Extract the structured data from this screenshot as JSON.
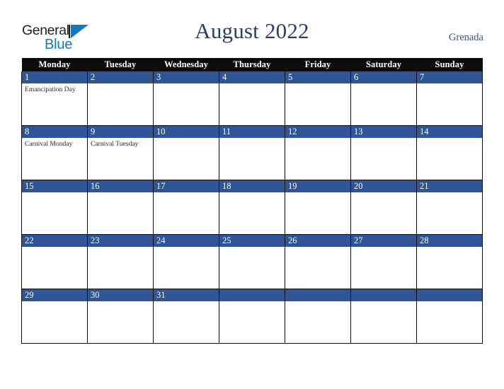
{
  "brand": {
    "name_part1": "General",
    "name_part2": "Blue",
    "mark_icon": "triangle-logo-icon",
    "color_dark": "#231f20",
    "color_blue": "#1878be"
  },
  "header": {
    "title": "August 2022",
    "region": "Grenada",
    "title_color": "#2b3f63",
    "region_color": "#3f5280"
  },
  "colors": {
    "header_row_bg": "#0c0c0c",
    "header_row_text": "#ffffff",
    "date_bar_bg": "#2f5597",
    "date_bar_text": "#ffffff",
    "cell_bg": "#fdfdfd",
    "grid_line": "#0c0c0c",
    "page_bg": "#fdfdfd",
    "event_text": "#2b2b2b"
  },
  "calendar": {
    "month": "August",
    "year": "2022",
    "weekday_headers": [
      "Monday",
      "Tuesday",
      "Wednesday",
      "Thursday",
      "Friday",
      "Saturday",
      "Sunday"
    ],
    "weeks": [
      [
        {
          "day": "1",
          "events": [
            "Emancipation Day"
          ]
        },
        {
          "day": "2",
          "events": []
        },
        {
          "day": "3",
          "events": []
        },
        {
          "day": "4",
          "events": []
        },
        {
          "day": "5",
          "events": []
        },
        {
          "day": "6",
          "events": []
        },
        {
          "day": "7",
          "events": []
        }
      ],
      [
        {
          "day": "8",
          "events": [
            "Carnival Monday"
          ]
        },
        {
          "day": "9",
          "events": [
            "Carnival Tuesday"
          ]
        },
        {
          "day": "10",
          "events": []
        },
        {
          "day": "11",
          "events": []
        },
        {
          "day": "12",
          "events": []
        },
        {
          "day": "13",
          "events": []
        },
        {
          "day": "14",
          "events": []
        }
      ],
      [
        {
          "day": "15",
          "events": []
        },
        {
          "day": "16",
          "events": []
        },
        {
          "day": "17",
          "events": []
        },
        {
          "day": "18",
          "events": []
        },
        {
          "day": "19",
          "events": []
        },
        {
          "day": "20",
          "events": []
        },
        {
          "day": "21",
          "events": []
        }
      ],
      [
        {
          "day": "22",
          "events": []
        },
        {
          "day": "23",
          "events": []
        },
        {
          "day": "24",
          "events": []
        },
        {
          "day": "25",
          "events": []
        },
        {
          "day": "26",
          "events": []
        },
        {
          "day": "27",
          "events": []
        },
        {
          "day": "28",
          "events": []
        }
      ],
      [
        {
          "day": "29",
          "events": []
        },
        {
          "day": "30",
          "events": []
        },
        {
          "day": "31",
          "events": []
        },
        {
          "day": "",
          "events": []
        },
        {
          "day": "",
          "events": []
        },
        {
          "day": "",
          "events": []
        },
        {
          "day": "",
          "events": []
        }
      ]
    ]
  }
}
